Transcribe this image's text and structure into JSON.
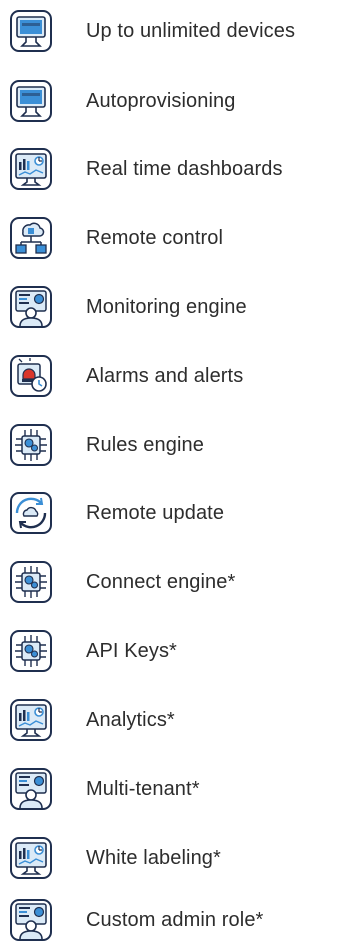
{
  "features": [
    {
      "label": "Up to unlimited devices",
      "icon": "devices-monitor-icon"
    },
    {
      "label": "Autoprovisioning",
      "icon": "devices-monitor-icon"
    },
    {
      "label": "Real time dashboards",
      "icon": "dashboard-chart-icon"
    },
    {
      "label": "Remote control",
      "icon": "network-control-icon"
    },
    {
      "label": "Monitoring engine",
      "icon": "monitoring-user-icon"
    },
    {
      "label": "Alarms and alerts",
      "icon": "alarm-clock-icon"
    },
    {
      "label": "Rules engine",
      "icon": "processor-chip-icon"
    },
    {
      "label": "Remote update",
      "icon": "cloud-update-icon"
    },
    {
      "label": "Connect engine*",
      "icon": "processor-chip-icon"
    },
    {
      "label": "API Keys*",
      "icon": "processor-chip-icon"
    },
    {
      "label": "Analytics*",
      "icon": "dashboard-chart-icon"
    },
    {
      "label": "Multi-tenant*",
      "icon": "monitoring-user-icon"
    },
    {
      "label": "White labeling*",
      "icon": "dashboard-chart-icon"
    },
    {
      "label": "Custom admin role*",
      "icon": "monitoring-user-icon"
    }
  ],
  "colors": {
    "icon_dark": "#1f2f4f",
    "icon_blue": "#3b8fd6",
    "icon_light": "#dbeaf7",
    "alarm_red": "#d9352b",
    "text": "#2d2d2d"
  }
}
